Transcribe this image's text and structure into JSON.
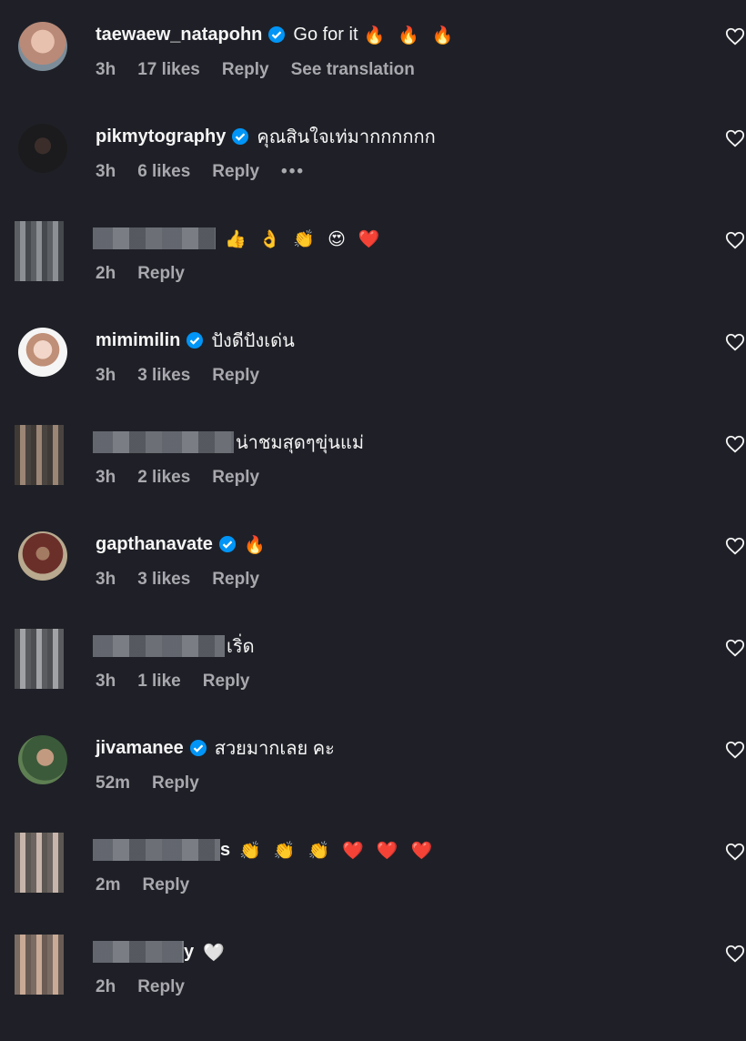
{
  "colors": {
    "background": "#1f2027",
    "verified": "#0095f6",
    "meta_text": "#a8a8ae"
  },
  "comments": [
    {
      "username": "taewaew_natapohn",
      "verified": true,
      "text": "Go for it",
      "emoji": "🔥 🔥 🔥",
      "time": "3h",
      "likes": "17 likes",
      "reply": "Reply",
      "extra": "See translation"
    },
    {
      "username": "pikmytography",
      "verified": true,
      "text": "คุณสินใจเท่มากกกกกก",
      "time": "3h",
      "likes": "6 likes",
      "reply": "Reply",
      "extra": "•••"
    },
    {
      "username": "",
      "verified": false,
      "text": "",
      "emoji": "👍 👌 👏 😍 ❤️",
      "time": "2h",
      "likes": "",
      "reply": "Reply"
    },
    {
      "username": "mimimilin",
      "verified": true,
      "text": "ปังดีปังเด่น",
      "time": "3h",
      "likes": "3 likes",
      "reply": "Reply"
    },
    {
      "username": "",
      "verified": false,
      "text": "น่าชมสุดๆขุ่นแม่",
      "time": "3h",
      "likes": "2 likes",
      "reply": "Reply"
    },
    {
      "username": "gapthanavate",
      "verified": true,
      "text": "",
      "emoji": "🔥",
      "time": "3h",
      "likes": "3 likes",
      "reply": "Reply"
    },
    {
      "username": "",
      "verified": false,
      "text": "เริ่ด",
      "time": "3h",
      "likes": "1 like",
      "reply": "Reply"
    },
    {
      "username": "jivamanee",
      "verified": true,
      "text": "สวยมากเลย คะ",
      "time": "52m",
      "likes": "",
      "reply": "Reply"
    },
    {
      "username": "s",
      "verified": false,
      "text": "",
      "emoji": "👏 👏 👏 ❤️ ❤️ ❤️",
      "time": "2m",
      "likes": "",
      "reply": "Reply"
    },
    {
      "username": "y",
      "verified": false,
      "text": "",
      "emoji": "🤍",
      "time": "2h",
      "likes": "",
      "reply": "Reply"
    }
  ]
}
